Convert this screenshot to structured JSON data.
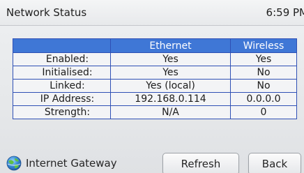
{
  "header": {
    "title": "Network Status",
    "time": "6:59 PM"
  },
  "table": {
    "columns": [
      "",
      "Ethernet",
      "Wireless"
    ],
    "rows": [
      {
        "label": "Enabled:",
        "ethernet": "Yes",
        "wireless": "Yes"
      },
      {
        "label": "Initialised:",
        "ethernet": "Yes",
        "wireless": "No"
      },
      {
        "label": "Linked:",
        "ethernet": "Yes (local)",
        "wireless": "No"
      },
      {
        "label": "IP Address:",
        "ethernet": "192.168.0.114",
        "wireless": "0.0.0.0"
      },
      {
        "label": "Strength:",
        "ethernet": "N/A",
        "wireless": "0"
      }
    ]
  },
  "footer": {
    "gateway_label": "Internet Gateway",
    "gateway_icon": "globe-icon",
    "refresh_label": "Refresh",
    "back_label": "Back"
  },
  "colors": {
    "header_row": "#3f77d6",
    "grid_lines": "#2f50b5",
    "background": "#e9ebed"
  }
}
